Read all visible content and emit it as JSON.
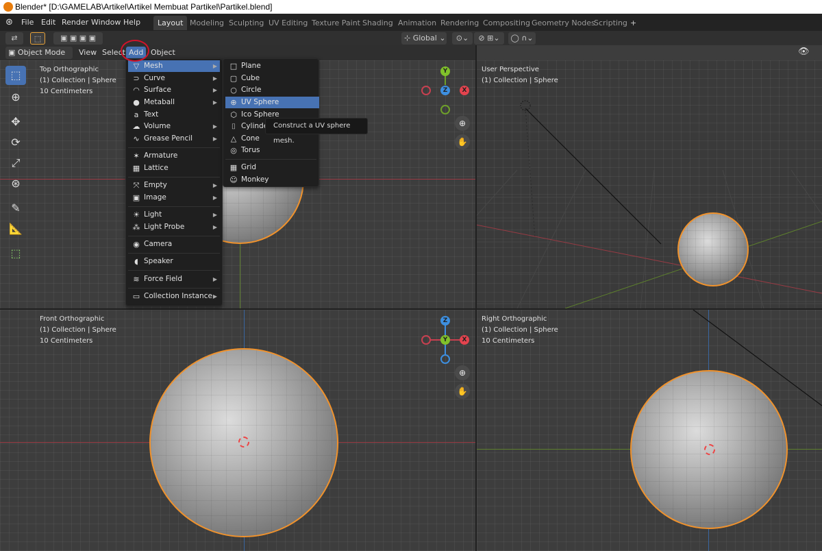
{
  "window": {
    "title": "Blender* [D:\\GAMELAB\\Artikel\\Artikel Membuat Partikel\\Partikel.blend]"
  },
  "topbar": {
    "menus": [
      "File",
      "Edit",
      "Render",
      "Window",
      "Help"
    ],
    "workspaces": [
      "Layout",
      "Modeling",
      "Sculpting",
      "UV Editing",
      "Texture Paint",
      "Shading",
      "Animation",
      "Rendering",
      "Compositing",
      "Geometry Nodes",
      "Scripting"
    ],
    "add_workspace": "+"
  },
  "toolrow": {
    "orientation": "Global"
  },
  "header": {
    "mode": "Object Mode",
    "menus": [
      "View",
      "Select",
      "Add",
      "Object"
    ]
  },
  "viewports": {
    "top_left": {
      "name": "Top Orthographic",
      "collection": "(1) Collection | Sphere",
      "scale": "10 Centimeters"
    },
    "top_right": {
      "name": "User Perspective",
      "collection": "(1) Collection | Sphere"
    },
    "bottom_left": {
      "name": "Front Orthographic",
      "collection": "(1) Collection | Sphere",
      "scale": "10 Centimeters"
    },
    "bottom_right": {
      "name": "Right Orthographic",
      "collection": "(1) Collection | Sphere",
      "scale": "10 Centimeters"
    }
  },
  "gizmo": {
    "y": "Y",
    "z": "Z",
    "x": "X"
  },
  "add_menu": {
    "items": [
      {
        "label": "Mesh",
        "icon": "mesh-icon",
        "glyph": "▽",
        "submenu": true,
        "highlighted": true
      },
      {
        "label": "Curve",
        "icon": "curve-icon",
        "glyph": "⊃",
        "submenu": true
      },
      {
        "label": "Surface",
        "icon": "surface-icon",
        "glyph": "◠",
        "submenu": true
      },
      {
        "label": "Metaball",
        "icon": "metaball-icon",
        "glyph": "●",
        "submenu": true
      },
      {
        "label": "Text",
        "icon": "text-icon",
        "glyph": "a",
        "submenu": false
      },
      {
        "label": "Volume",
        "icon": "volume-icon",
        "glyph": "☁",
        "submenu": true
      },
      {
        "label": "Grease Pencil",
        "icon": "grease-pencil-icon",
        "glyph": "∿",
        "submenu": true
      },
      {
        "label": "Armature",
        "icon": "armature-icon",
        "glyph": "✶",
        "submenu": false
      },
      {
        "label": "Lattice",
        "icon": "lattice-icon",
        "glyph": "▦",
        "submenu": false
      },
      {
        "label": "Empty",
        "icon": "empty-icon",
        "glyph": "⤧",
        "submenu": true
      },
      {
        "label": "Image",
        "icon": "image-icon",
        "glyph": "▣",
        "submenu": true
      },
      {
        "label": "Light",
        "icon": "light-icon",
        "glyph": "☀",
        "submenu": true
      },
      {
        "label": "Light Probe",
        "icon": "light-probe-icon",
        "glyph": "⁂",
        "submenu": true
      },
      {
        "label": "Camera",
        "icon": "camera-icon",
        "glyph": "◉",
        "submenu": false
      },
      {
        "label": "Speaker",
        "icon": "speaker-icon",
        "glyph": "◖",
        "submenu": false
      },
      {
        "label": "Force Field",
        "icon": "force-field-icon",
        "glyph": "≋",
        "submenu": true
      },
      {
        "label": "Collection Instance",
        "icon": "collection-icon",
        "glyph": "▭",
        "submenu": true
      }
    ]
  },
  "mesh_menu": {
    "items": [
      {
        "label": "Plane",
        "icon": "plane-icon",
        "glyph": "□"
      },
      {
        "label": "Cube",
        "icon": "cube-icon",
        "glyph": "▢"
      },
      {
        "label": "Circle",
        "icon": "circle-icon",
        "glyph": "○"
      },
      {
        "label": "UV Sphere",
        "icon": "uv-sphere-icon",
        "glyph": "⊕",
        "highlighted": true
      },
      {
        "label": "Ico Sphere",
        "icon": "ico-sphere-icon",
        "glyph": "⬡"
      },
      {
        "label": "Cylinder",
        "icon": "cylinder-icon",
        "glyph": "⌷"
      },
      {
        "label": "Cone",
        "icon": "cone-icon",
        "glyph": "△"
      },
      {
        "label": "Torus",
        "icon": "torus-icon",
        "glyph": "◎"
      },
      {
        "label": "Grid",
        "icon": "grid-icon",
        "glyph": "▦"
      },
      {
        "label": "Monkey",
        "icon": "monkey-icon",
        "glyph": "☺"
      }
    ]
  },
  "tooltip": "Construct a UV sphere mesh.",
  "colors": {
    "highlight": "#4772b3",
    "selection_outline": "#f0922c",
    "annotation": "#d2132b",
    "x_axis": "#e3434e",
    "y_axis": "#80c12a",
    "z_axis": "#3d8fe0"
  }
}
